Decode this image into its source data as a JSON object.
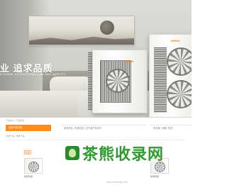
{
  "hero": {
    "tagline": "业 追求品质",
    "tagline_en": "ETERNAL PROFESSIONALISM AND QUALITY",
    "product_logo": "KRPRO"
  },
  "breadcrumb": "产品中心 / 产品列表",
  "categories": [
    {
      "label": "全部产品分类",
      "active": true
    },
    {
      "label": "家用热泵 / 商用热泵 / 空气能产品系列",
      "active": false
    },
    {
      "label": "热水器 / 采暖 / 配件",
      "active": false
    }
  ],
  "sub_filter": "全部产品 / 热泵产品",
  "products": [
    {
      "badge": "新品",
      "name": "热泵机组"
    },
    {
      "badge": "新品",
      "name": "热泵机组"
    }
  ],
  "watermark": {
    "text": "茶熊收录网",
    "url": "www.chaxiong.com"
  },
  "colors": {
    "accent": "#ff8c1a",
    "watermark_green": "#2e9a2f"
  }
}
